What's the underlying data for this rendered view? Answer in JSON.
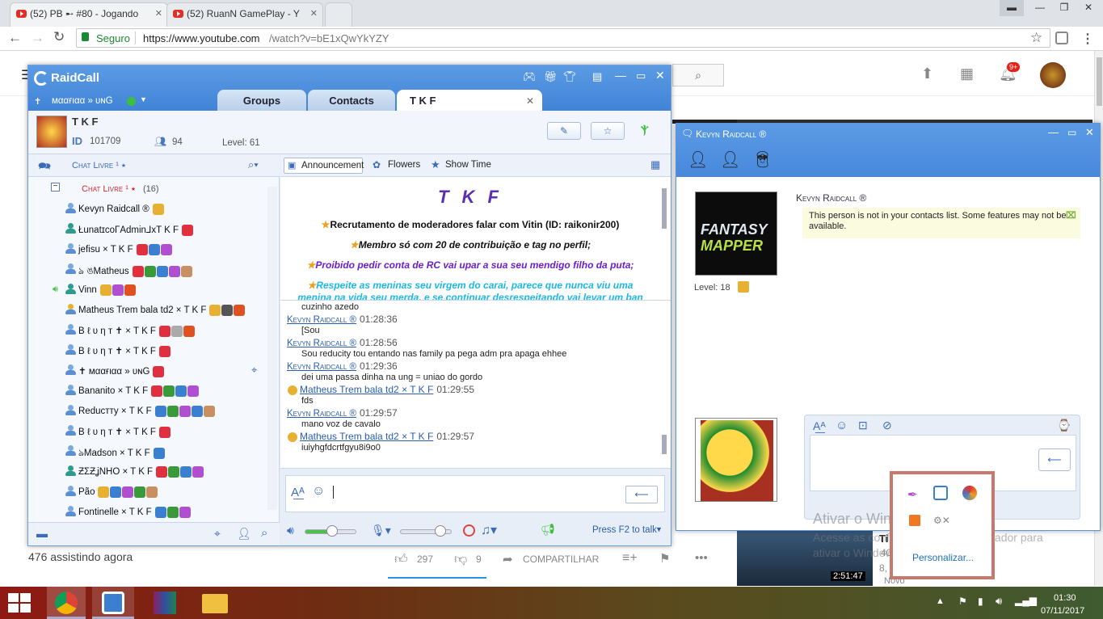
{
  "browser": {
    "tabs": [
      {
        "label": "(52) PB ➸ #80 - Jogando"
      },
      {
        "label": "(52) RuanN GamePlay - Y"
      }
    ],
    "secure_label": "Seguro",
    "url": "https://www.youtube.com/watch?v=bE1xQwYkYZY",
    "url_host": "https://www.youtube.com",
    "url_path": "/watch?v=bE1xQwYkYZY"
  },
  "youtube": {
    "notif_count": "9+",
    "viewers": "476 assistindo agora",
    "likes": "297",
    "dislikes": "9",
    "share_label": "COMPARTILHAR",
    "video_duration": "2:51:47",
    "video_title_part": "Ti",
    "video_novo": "Novo",
    "video_views_part": "40",
    "video_small": "8,"
  },
  "raidcall": {
    "app_name": "RaidCall",
    "user_name": "ᴍααғιαα » υɴG",
    "tabs": [
      "Groups",
      "Contacts",
      "T K F"
    ],
    "group_name": "T K F",
    "id_label": "ID",
    "group_id": "101709",
    "member_count": "94",
    "level": "Level: 61",
    "channel_header": "Chat Livre ¹ ⭑",
    "channel_name": "Chat Livre ¹ ⭑",
    "channel_count": "(16)",
    "members": [
      {
        "name": "Kevyn Raidcall ®"
      },
      {
        "name": "ŁunatɪcoΓAdmin⅃хT K F"
      },
      {
        "name": "jefisu  × T K F"
      },
      {
        "name": "ঌ     ঙMatheus"
      },
      {
        "name": "Vinn"
      },
      {
        "name": "Matheus Trem bala td2 × T K F"
      },
      {
        "name": "B ℓ υ η т ✝ × T K F"
      },
      {
        "name": "B ℓ υ η т ✝ × T K F"
      },
      {
        "name": "✝      ᴍααғιαα » υɴG"
      },
      {
        "name": "Bananito × T K F"
      },
      {
        "name": "Reducтту    × T K F"
      },
      {
        "name": "B ℓ υ η т ✝ × T K F"
      },
      {
        "name": "ঌMadson × T K F"
      },
      {
        "name": "ƵΣƵʝNHO × T K F"
      },
      {
        "name": "Pão"
      },
      {
        "name": "Fontinelle × T K F"
      }
    ],
    "toolbar": {
      "announcement": "Announcement",
      "flowers": "Flowers",
      "showtime": "Show Time"
    },
    "announcement_title": "T K F",
    "announcement_lines": [
      "Recrutamento de moderadores falar com Vitin (ID: raikonir200)",
      "Membro só com 20 de contribuição e tag no perfil;",
      "Proibido pedir conta de RC vai upar a sua seu mendigo filho da puta;",
      "Respeite as meninas seu virgem do carai, parece que nunca viu uma",
      "menina na vida seu merda, e se continuar desrespeitando vai levar um ban"
    ],
    "chat": [
      {
        "sender": "",
        "time": "",
        "text": "cuzinho azedo"
      },
      {
        "sender": "Kevyn Raidcall ®",
        "time": "01:28:36",
        "text": "[Sou"
      },
      {
        "sender": "Kevyn Raidcall ®",
        "time": "01:28:56",
        "text": "Sou reducity tou entando nas family pa pega adm pra apaga ehhee"
      },
      {
        "sender": "Kevyn Raidcall ®",
        "time": "01:29:36",
        "text": "dei uma passa dinha na ung = uniao do gordo"
      },
      {
        "sender": "Matheus Trem bala td2 × T K F",
        "time": "01:29:55",
        "text": "fds"
      },
      {
        "sender": "Kevyn Raidcall ®",
        "time": "01:29:57",
        "text": "mano voz de cavalo"
      },
      {
        "sender": "Matheus Trem bala td2 × T K F",
        "time": "01:29:57",
        "text": "iuiyhgfdcrtfgyu8i9o0"
      }
    ],
    "press_to_talk": "Press F2 to talk",
    "volume_level": 0.55,
    "mic_level": 0.8
  },
  "kevyn_window": {
    "title": "Kevyn Raidcall ®",
    "name": "Kevyn Raidcall ®",
    "notice": "This person is not in your contacts list. Some features may not be available.",
    "level": "Level: 18",
    "avatar_text_1": "FANTASY",
    "avatar_text_2": "MAPPER"
  },
  "watermark": {
    "line1": "Ativar o Windows",
    "line2": "Acesse as configurações do computador para",
    "line3": "ativar o Windows."
  },
  "tray_popup": {
    "customize": "Personalizar..."
  },
  "taskbar": {
    "time": "01:30",
    "date": "07/11/2017"
  }
}
